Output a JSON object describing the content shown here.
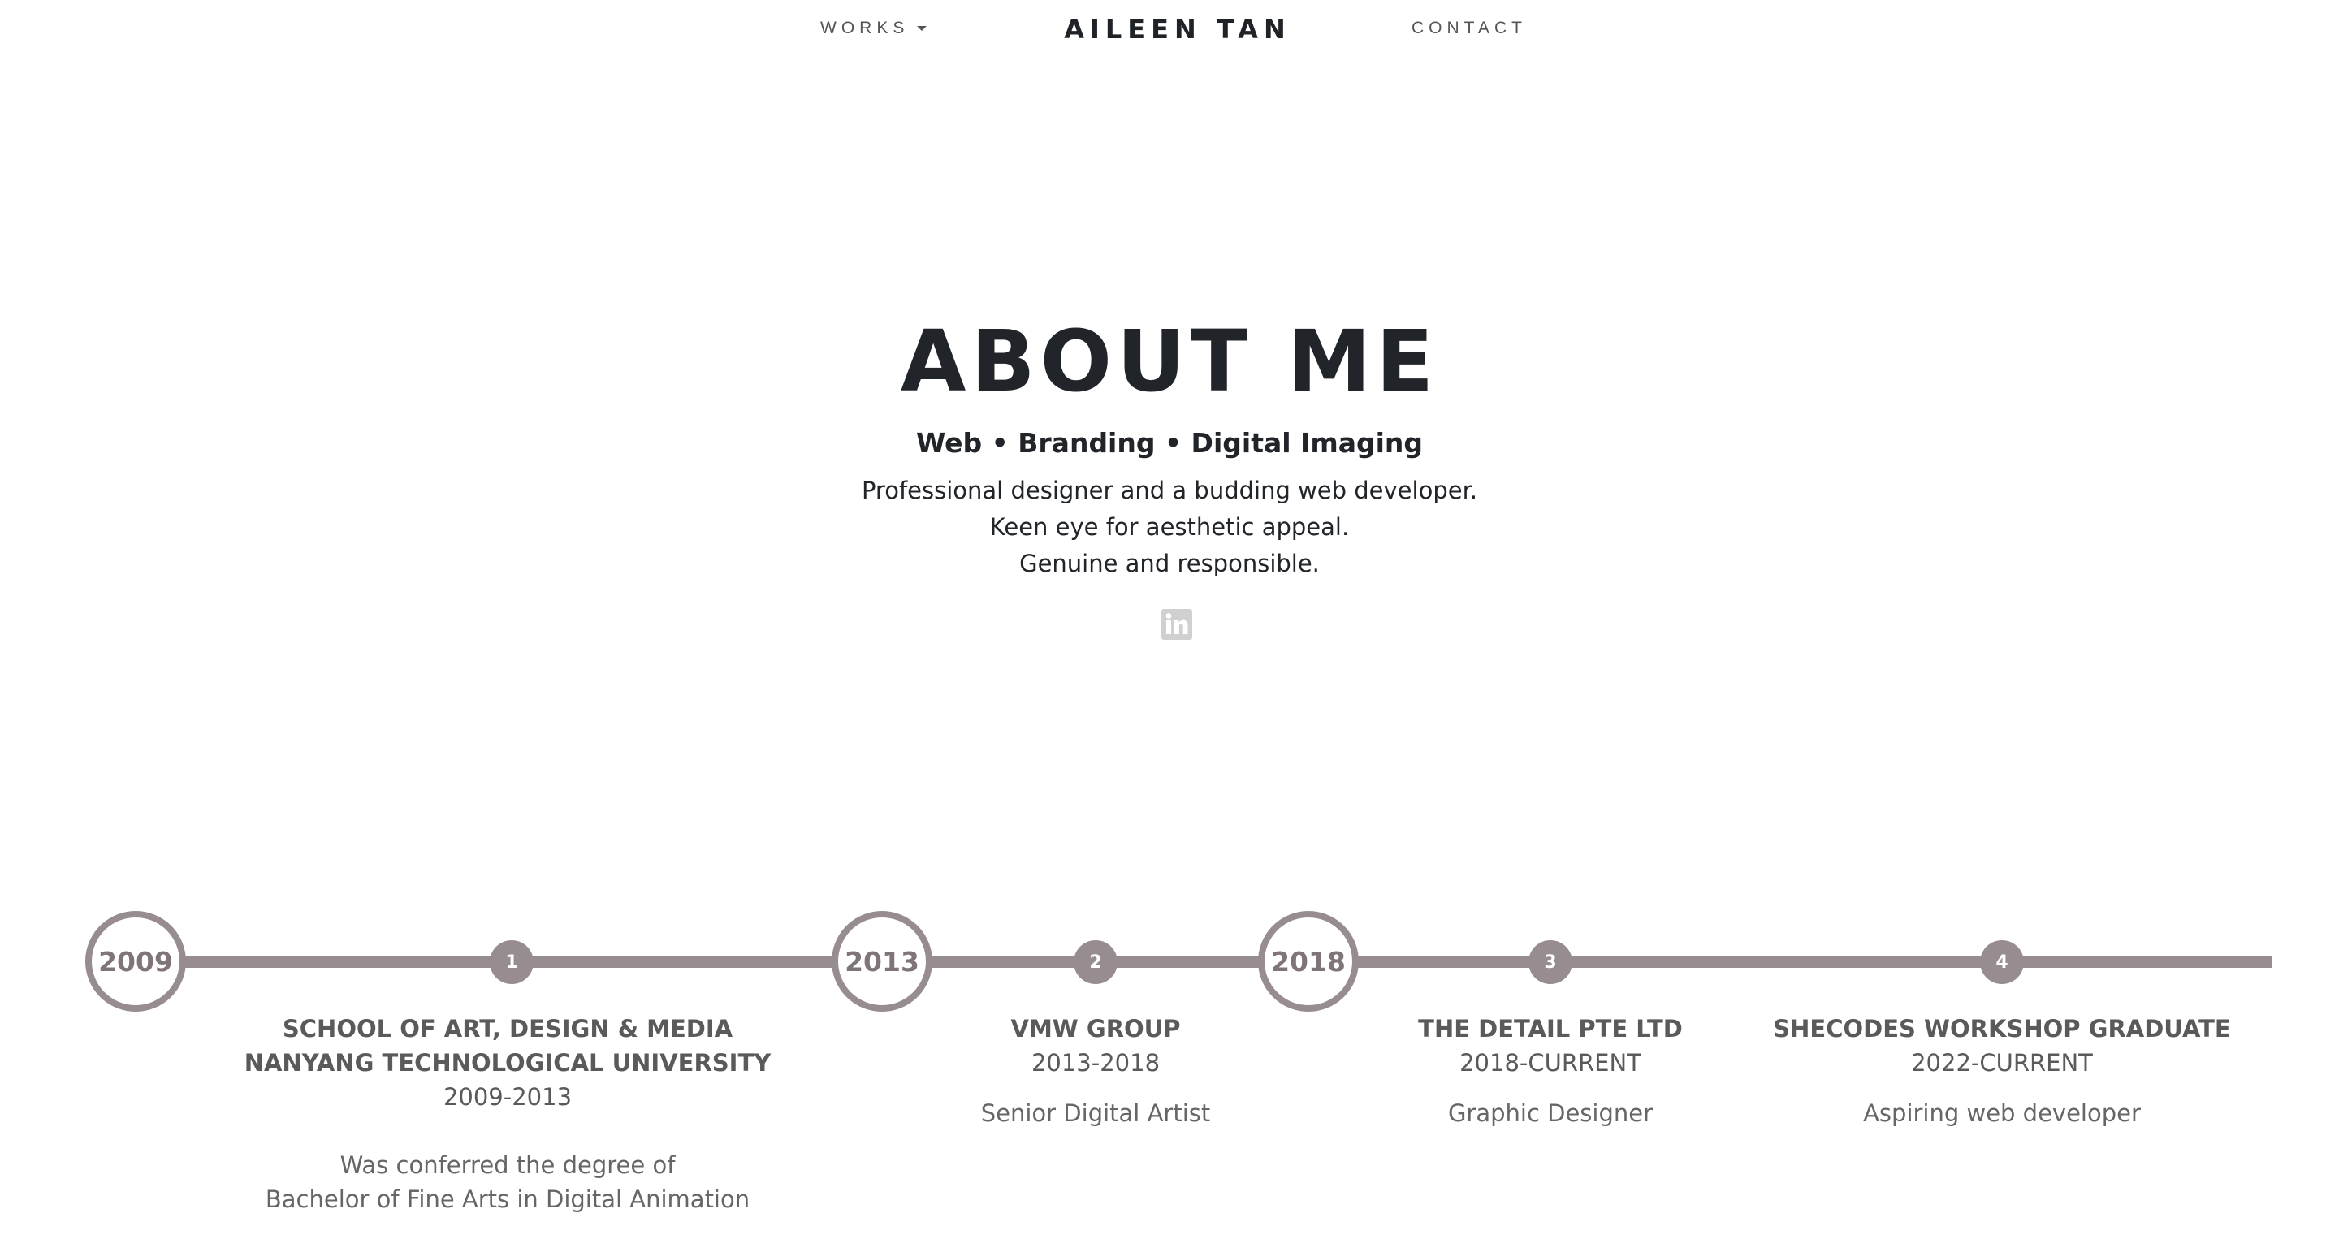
{
  "nav": {
    "works_label": "WORKS",
    "brand": "AILEEN TAN",
    "contact_label": "CONTACT",
    "works_icon": "caret-down-icon"
  },
  "hero": {
    "title": "ABOUT ME",
    "subtitle": "Web • Branding • Digital Imaging",
    "description": [
      "Professional designer and a budding web developer.",
      "Keen eye for aesthetic appeal.",
      "Genuine and responsible."
    ],
    "social_icon": "linkedin-icon"
  },
  "timeline": {
    "years": [
      "2009",
      "2013",
      "2018"
    ],
    "entries": [
      {
        "number": "1",
        "title_lines": [
          "SCHOOL OF ART, DESIGN & MEDIA",
          "NANYANG TECHNOLOGICAL UNIVERSITY"
        ],
        "period": "2009-2013",
        "desc_lines": [
          "Was conferred the degree of",
          "Bachelor of Fine Arts in Digital Animation"
        ]
      },
      {
        "number": "2",
        "title_lines": [
          "VMW GROUP"
        ],
        "period": "2013-2018",
        "role": "Senior Digital Artist"
      },
      {
        "number": "3",
        "title_lines": [
          "THE DETAIL PTE LTD"
        ],
        "period": "2018-CURRENT",
        "role": "Graphic Designer"
      },
      {
        "number": "4",
        "title_lines": [
          "SHECODES WORKSHOP GRADUATE"
        ],
        "period": "2022-CURRENT",
        "role": "Aspiring web developer"
      }
    ]
  },
  "colors": {
    "text_dark": "#212529",
    "timeline_accent": "#978d91",
    "timeline_text": "#5a5a5a",
    "icon_muted": "#d0d0d0"
  }
}
